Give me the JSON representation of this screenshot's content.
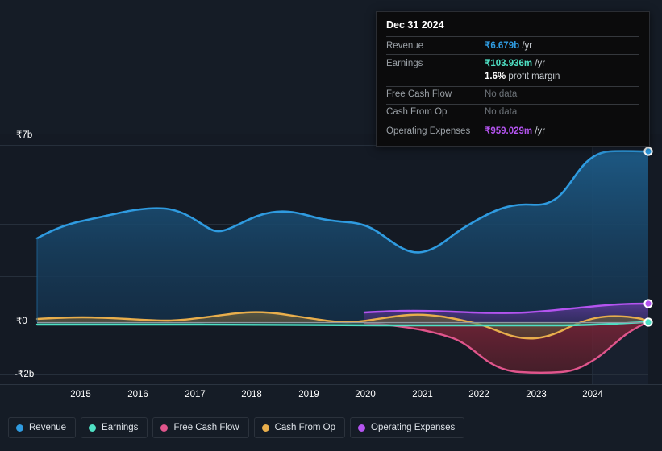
{
  "axes": {
    "y_labels": [
      {
        "text": "₹7b",
        "value": 7000000000
      },
      {
        "text": "₹0",
        "value": 0
      },
      {
        "text": "-₹2b",
        "value": -2000000000
      }
    ],
    "x_labels": [
      "2015",
      "2016",
      "2017",
      "2018",
      "2019",
      "2020",
      "2021",
      "2022",
      "2023",
      "2024"
    ]
  },
  "tooltip": {
    "title": "Dec 31 2024",
    "rows": [
      {
        "key": "Revenue",
        "amount": "₹6.679b",
        "unit": "/yr",
        "color": "#2f9be0",
        "nodata": false
      },
      {
        "key": "Earnings",
        "amount": "₹103.936m",
        "unit": "/yr",
        "color": "#4fe0c4",
        "nodata": false
      },
      {
        "key": "",
        "amount": "1.6%",
        "unit": "profit margin",
        "color": "#ffffff",
        "nodata": false,
        "margin": true
      },
      {
        "key": "Free Cash Flow",
        "amount": "No data",
        "unit": "",
        "color": "#6c7278",
        "nodata": true
      },
      {
        "key": "Cash From Op",
        "amount": "No data",
        "unit": "",
        "color": "#6c7278",
        "nodata": true
      },
      {
        "key": "Operating Expenses",
        "amount": "₹959.029m",
        "unit": "/yr",
        "color": "#b454f0",
        "nodata": false
      }
    ]
  },
  "legend": {
    "items": [
      {
        "label": "Revenue",
        "color": "#2f9be0"
      },
      {
        "label": "Earnings",
        "color": "#4fe0c4"
      },
      {
        "label": "Free Cash Flow",
        "color": "#e0558c"
      },
      {
        "label": "Cash From Op",
        "color": "#e8ae4c"
      },
      {
        "label": "Operating Expenses",
        "color": "#b454f0"
      }
    ]
  },
  "chart_data": {
    "type": "area",
    "title": "",
    "xlabel": "",
    "ylabel": "",
    "currency": "INR",
    "ylim": [
      -2000000000,
      7000000000
    ],
    "grid": true,
    "legend_position": "bottom",
    "x": [
      2014.5,
      2015,
      2015.5,
      2016,
      2016.5,
      2017,
      2017.5,
      2018,
      2018.5,
      2019,
      2019.5,
      2020,
      2020.5,
      2021,
      2021.5,
      2022,
      2022.5,
      2023,
      2023.5,
      2024,
      2024.5,
      2024.95
    ],
    "series": [
      {
        "name": "Revenue",
        "color": "#2f9be0",
        "values": [
          3.18,
          3.52,
          3.64,
          3.78,
          3.62,
          3.44,
          3.58,
          3.72,
          3.76,
          3.62,
          3.58,
          3.52,
          3.3,
          3.0,
          3.1,
          3.42,
          3.8,
          4.1,
          4.12,
          4.9,
          6.4,
          6.679
        ],
        "units": "billions INR"
      },
      {
        "name": "Earnings",
        "color": "#4fe0c4",
        "values": [
          -0.06,
          -0.06,
          -0.06,
          -0.06,
          -0.07,
          -0.07,
          -0.07,
          -0.07,
          -0.07,
          -0.07,
          -0.07,
          -0.07,
          -0.07,
          -0.07,
          -0.07,
          -0.07,
          -0.07,
          -0.07,
          -0.07,
          0.02,
          0.09,
          0.103936
        ],
        "units": "billions INR"
      },
      {
        "name": "Free Cash Flow",
        "color": "#e0558c",
        "values": [
          null,
          null,
          null,
          null,
          null,
          null,
          null,
          null,
          null,
          null,
          null,
          -0.03,
          -0.1,
          -0.2,
          -0.36,
          -0.62,
          -1.05,
          -1.32,
          -1.33,
          -1.05,
          -0.42,
          -0.07
        ],
        "units": "billions INR",
        "starts_at": 2020
      },
      {
        "name": "Cash From Op",
        "color": "#e8ae4c",
        "values": [
          0.09,
          0.11,
          0.12,
          0.13,
          0.12,
          0.1,
          0.14,
          0.18,
          0.19,
          0.17,
          0.13,
          0.1,
          0.04,
          0.02,
          0.06,
          0.12,
          0.14,
          0.02,
          -0.16,
          -0.24,
          -0.1,
          0.06
        ],
        "units": "billions INR"
      },
      {
        "name": "Operating Expenses",
        "color": "#b454f0",
        "values": [
          null,
          null,
          null,
          null,
          null,
          null,
          null,
          null,
          null,
          null,
          null,
          0.36,
          0.4,
          0.42,
          0.44,
          0.46,
          0.52,
          0.55,
          0.58,
          0.64,
          0.86,
          0.959029
        ],
        "units": "billions INR",
        "starts_at": 2020
      }
    ],
    "highlight_band": {
      "from": 2024.05,
      "to": 2024.95,
      "label": ""
    }
  }
}
